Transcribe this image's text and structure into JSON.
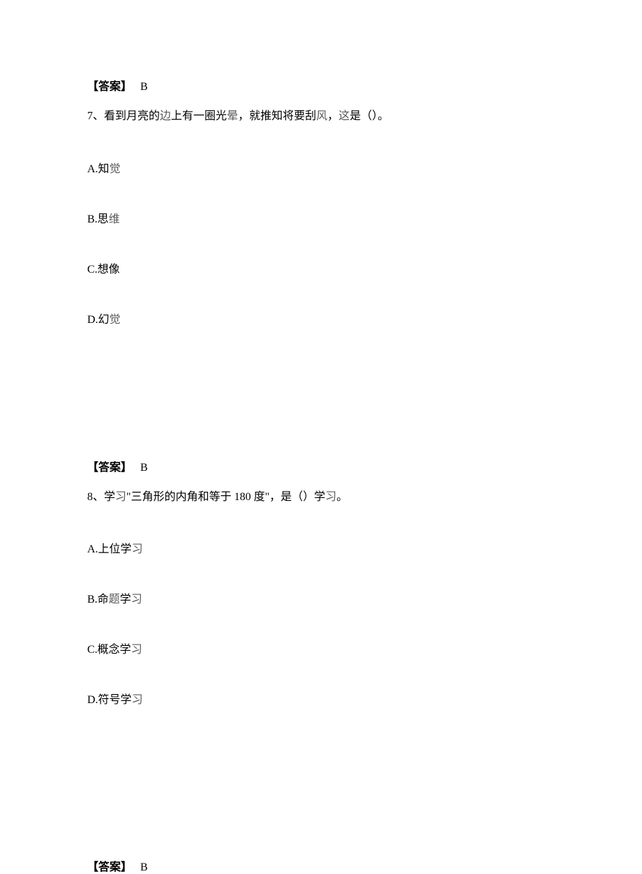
{
  "q7_prev_answer": {
    "label": "【答案】",
    "value": "B"
  },
  "q7": {
    "number": "7、",
    "text_part1": "看到月亮的",
    "text_gray1": "边",
    "text_part2": "上有一圈光",
    "text_gray2": "晕",
    "text_part3": "，就推知将要刮",
    "text_gray3": "风",
    "text_part4": "，",
    "text_gray4": "这",
    "text_part5": "是（）。",
    "options": {
      "a": "A.知",
      "a_gray": "觉",
      "b": "B.思",
      "b_gray": "维",
      "c": "C.想像",
      "d": "D.幻",
      "d_gray": "觉"
    },
    "answer": {
      "label": "【答案】",
      "value": "B"
    }
  },
  "q8": {
    "number": "8、",
    "text_part1": "学",
    "text_gray1": "习",
    "text_part2": "\"三角形的内角和等于 180 度\"，是（）学",
    "text_gray2": "习",
    "text_part3": "。",
    "options": {
      "a": "A.上位学",
      "a_gray": "习",
      "b": "B.命",
      "b_gray1": "题",
      "b_mid": "学",
      "b_gray2": "习",
      "c": "C.概念学",
      "c_gray": "习",
      "d": "D.符号学",
      "d_gray": "习"
    },
    "answer": {
      "label": "【答案】",
      "value": "B"
    }
  }
}
